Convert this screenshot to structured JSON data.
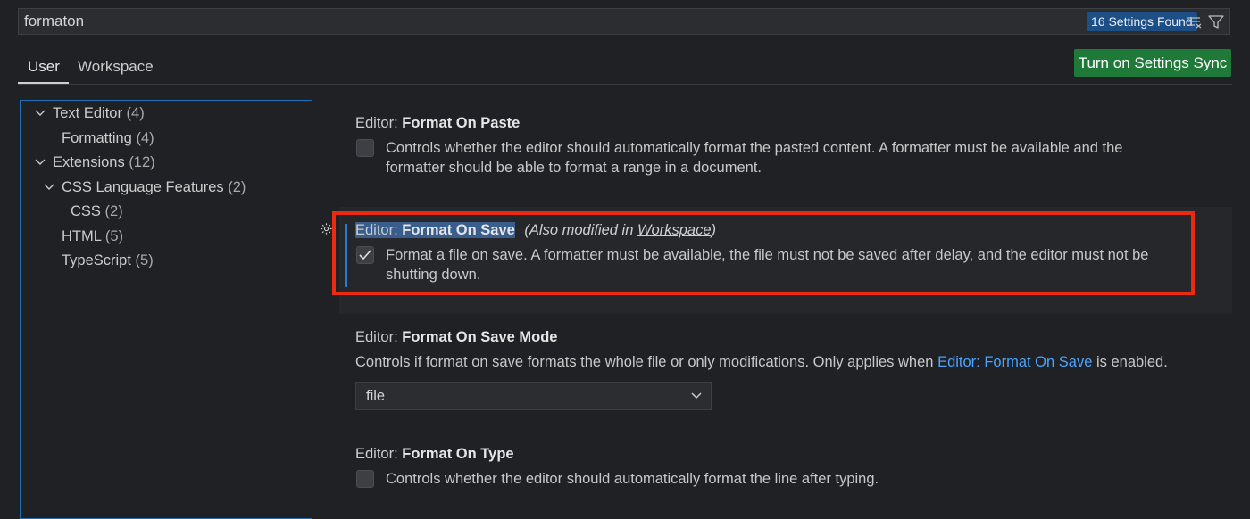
{
  "search": {
    "value": "formaton",
    "results_badge": "16 Settings Found",
    "clear_icon": "clear-filter-icon",
    "filter_icon": "filter-icon"
  },
  "tabs": [
    {
      "label": "User",
      "active": true
    },
    {
      "label": "Workspace",
      "active": false
    }
  ],
  "sync_button": {
    "label": "Turn on Settings Sync",
    "color": "#1f7a3a"
  },
  "toc": [
    {
      "label": "Text Editor",
      "count": "(4)",
      "expanded": true
    },
    {
      "label": "Formatting",
      "count": "(4)"
    },
    {
      "label": "Extensions",
      "count": "(12)",
      "expanded": true
    },
    {
      "label": "CSS Language Features",
      "count": "(2)",
      "expanded": true
    },
    {
      "label": "CSS",
      "count": "(2)"
    },
    {
      "label": "HTML",
      "count": "(5)"
    },
    {
      "label": "TypeScript",
      "count": "(5)"
    }
  ],
  "settings": {
    "format_on_paste": {
      "category": "Editor: ",
      "name": "Format On Paste",
      "description_line1": "Controls whether the editor should automatically format the pasted content. A formatter must be available and the",
      "description_line2": "formatter should be able to format a range in a document.",
      "checked": false
    },
    "format_on_save": {
      "category": "Editor: ",
      "name": "Format On Save",
      "note_prefix": "(Also modified in ",
      "note_link": "Workspace",
      "note_suffix": ")",
      "description_line1": "Format a file on save. A formatter must be available, the file must not be saved after delay, and the editor must not be",
      "description_line2": "shutting down.",
      "checked": true
    },
    "format_on_save_mode": {
      "category": "Editor: ",
      "name": "Format On Save Mode",
      "description_before": "Controls if format on save formats the whole file or only modifications. Only applies when ",
      "description_link": "Editor: Format On Save",
      "description_after": " is enabled.",
      "selected": "file"
    },
    "format_on_type": {
      "category": "Editor: ",
      "name": "Format On Type",
      "description": "Controls whether the editor should automatically format the line after typing.",
      "checked": false
    }
  },
  "colors": {
    "highlight": "#ea2a12",
    "link": "#4aa3ff",
    "accent": "#1e6fb5"
  }
}
